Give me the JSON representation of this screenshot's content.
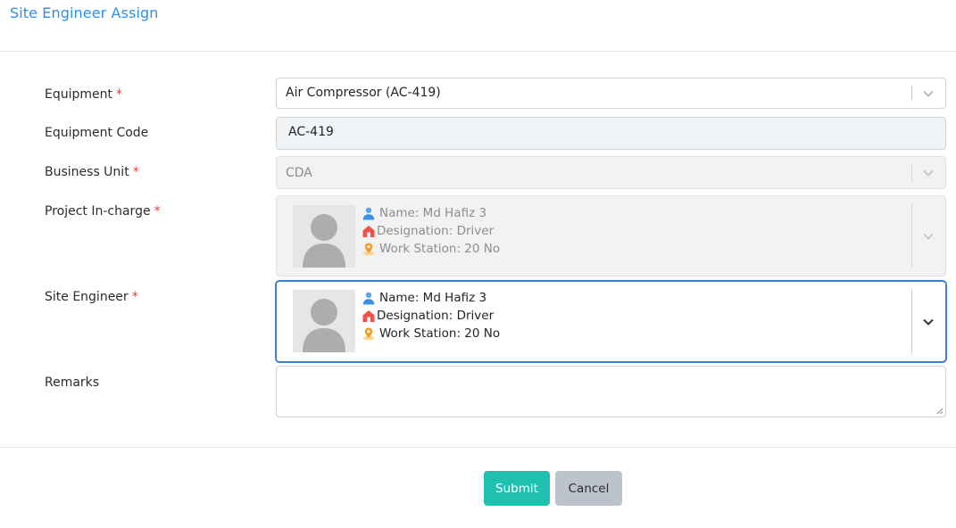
{
  "header": {
    "title": "Site Engineer Assign"
  },
  "form": {
    "equipment": {
      "label": "Equipment",
      "required": "*",
      "value": "Air Compressor (AC-419)"
    },
    "equipment_code": {
      "label": "Equipment Code",
      "value": "AC-419"
    },
    "business_unit": {
      "label": "Business Unit",
      "required": "*",
      "value": "CDA"
    },
    "project_incharge": {
      "label": "Project In-charge",
      "required": "*",
      "name": "Name: Md Hafiz 3",
      "designation": "Designation: Driver",
      "work_station": "Work Station: 20 No"
    },
    "site_engineer": {
      "label": "Site Engineer",
      "required": "*",
      "name": "Name: Md Hafiz 3",
      "designation": "Designation: Driver",
      "work_station": "Work Station: 20 No"
    },
    "remarks": {
      "label": "Remarks",
      "value": ""
    }
  },
  "buttons": {
    "submit": "Submit",
    "cancel": "Cancel"
  },
  "colors": {
    "accent": "#2e8fe8",
    "submit": "#20c0b0",
    "cancel": "#bcc3cd",
    "required": "#e53935",
    "focus": "#3b82d6"
  },
  "icons": [
    "user-icon",
    "house-icon",
    "location-icon",
    "chevron-down-icon",
    "avatar-placeholder-icon"
  ]
}
